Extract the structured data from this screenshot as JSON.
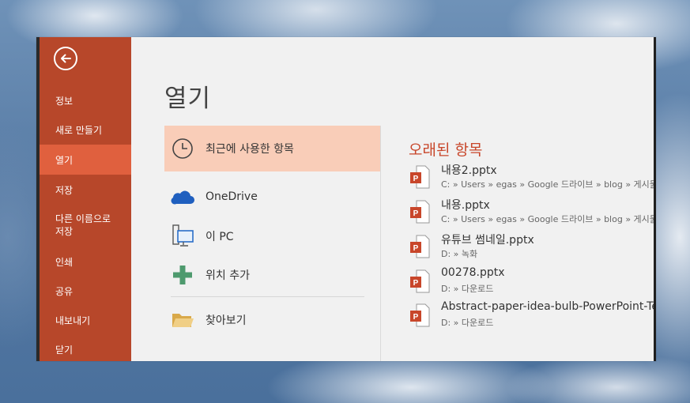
{
  "sidebar": {
    "items": [
      {
        "label": "정보"
      },
      {
        "label": "새로 만들기"
      },
      {
        "label": "열기"
      },
      {
        "label": "저장"
      },
      {
        "label": "다른 이름으로\n저장"
      },
      {
        "label": "인쇄"
      },
      {
        "label": "공유"
      },
      {
        "label": "내보내기"
      },
      {
        "label": "닫기"
      }
    ],
    "active_index": 2
  },
  "main": {
    "title": "열기",
    "locations": [
      {
        "label": "최근에 사용한 항목",
        "icon": "clock-icon",
        "selected": true
      },
      {
        "label": "OneDrive",
        "icon": "cloud-icon"
      },
      {
        "label": "이 PC",
        "icon": "computer-icon"
      },
      {
        "label": "위치 추가",
        "icon": "plus-icon"
      },
      {
        "label": "찾아보기",
        "icon": "folder-icon"
      }
    ],
    "recent_title": "오래된 항목",
    "files": [
      {
        "name": "내용2.pptx",
        "path": "C: » Users » egas » Google 드라이브 » blog » 게시물"
      },
      {
        "name": "내용.pptx",
        "path": "C: » Users » egas » Google 드라이브 » blog » 게시물"
      },
      {
        "name": "유튜브 썸네일.pptx",
        "path": "D: » 녹화"
      },
      {
        "name": "00278.pptx",
        "path": "D: » 다운로드"
      },
      {
        "name": "Abstract-paper-idea-bulb-PowerPoint-Templates.pptx",
        "path": "D: » 다운로드"
      }
    ]
  },
  "colors": {
    "sidebar_bg": "#b7472a",
    "sidebar_active": "#e0603e",
    "selected_location": "#f9cdb8",
    "accent_text": "#c8462a",
    "onedrive_blue": "#1f5fbf",
    "add_green": "#4e9a6e",
    "folder_yellow": "#e8c170"
  }
}
